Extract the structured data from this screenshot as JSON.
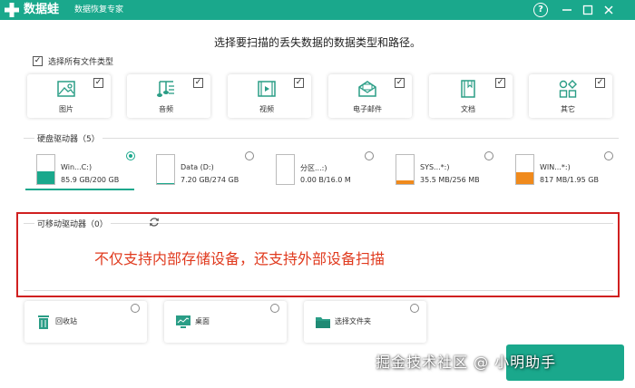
{
  "titlebar": {
    "app_name": "数据蛙",
    "app_subtitle": "数据恢复专家",
    "help_label": "?",
    "bg_color": "#1aa88c"
  },
  "heading": "选择要扫描的丢失数据的数据类型和路径。",
  "select_all": {
    "label": "选择所有文件类型",
    "checked": true
  },
  "file_types": [
    {
      "label": "图片",
      "icon": "image-icon",
      "checked": true
    },
    {
      "label": "音频",
      "icon": "music-icon",
      "checked": true
    },
    {
      "label": "视频",
      "icon": "video-icon",
      "checked": true
    },
    {
      "label": "电子邮件",
      "icon": "email-icon",
      "checked": true
    },
    {
      "label": "文档",
      "icon": "document-icon",
      "checked": true
    },
    {
      "label": "其它",
      "icon": "other-icon",
      "checked": true
    }
  ],
  "hard_drives": {
    "label": "硬盘驱动器（5）",
    "items": [
      {
        "name": "Win...C:)",
        "size": "85.9 GB/200 GB",
        "fill_percent": 43,
        "fill_color": "#1aa88c",
        "selected": true
      },
      {
        "name": "Data (D:)",
        "size": "7.20 GB/274 GB",
        "fill_percent": 3,
        "fill_color": "#1aa88c",
        "selected": false
      },
      {
        "name": "分区...:)",
        "size": "0.00  B/16.0 M",
        "fill_percent": 0,
        "fill_color": "#1aa88c",
        "selected": false
      },
      {
        "name": "SYS...*:)",
        "size": "35.5 MB/256 MB",
        "fill_percent": 14,
        "fill_color": "#f08a1c",
        "selected": false
      },
      {
        "name": "WIN...*:)",
        "size": "817 MB/1.95 GB",
        "fill_percent": 41,
        "fill_color": "#f08a1c",
        "selected": false
      }
    ]
  },
  "removable": {
    "label": "可移动驱动器（0）"
  },
  "annotation": "不仅支持内部存储设备，还支持外部设备扫描",
  "locations": [
    {
      "label": "回收站",
      "icon": "recycle-bin-icon"
    },
    {
      "label": "桌面",
      "icon": "desktop-icon"
    },
    {
      "label": "选择文件夹",
      "icon": "folder-icon"
    }
  ],
  "watermark": "掘金技术社区 @ 小明助手"
}
